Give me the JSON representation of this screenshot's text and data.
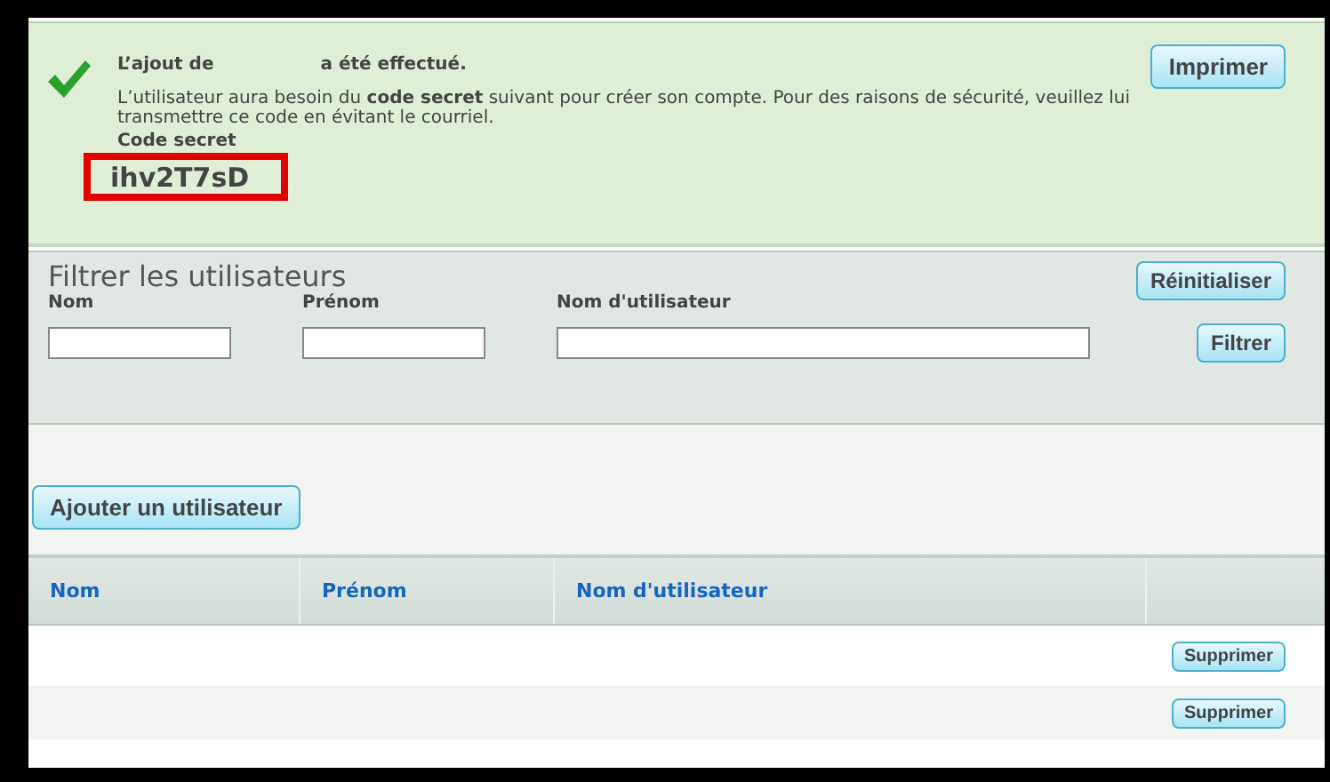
{
  "notice": {
    "title_before": "L’ajout de",
    "title_after": "a été effectué.",
    "message": "L’utilisateur aura besoin du **code secret** suivant pour créer son compte. Pour des raisons de sécurité, veuillez lui transmettre ce code en évitant le courriel.",
    "code_label": "Code secret",
    "code": "ihv2T7sD",
    "print_button": "Imprimer"
  },
  "filter": {
    "title": "Filtrer les utilisateurs",
    "reset_button": "Réinitialiser",
    "fields": [
      {
        "label": "Nom",
        "kind": "short"
      },
      {
        "label": "Prénom",
        "kind": "short"
      },
      {
        "label": "Nom d'utilisateur",
        "kind": "long"
      }
    ],
    "filter_button": "Filtrer"
  },
  "add_button": "Ajouter un utilisateur",
  "table": {
    "columns": [
      "Nom",
      "Prénom",
      "Nom d'utilisateur"
    ],
    "rows": [
      {
        "action": "Supprimer"
      },
      {
        "action": "Supprimer"
      }
    ]
  }
}
